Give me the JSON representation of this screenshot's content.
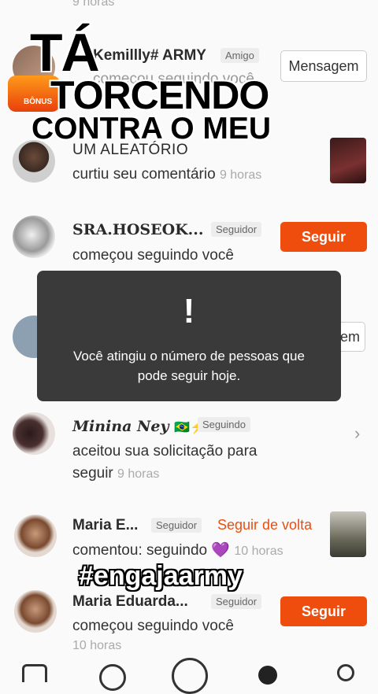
{
  "top_partial_time": "9 horas",
  "overlay": {
    "line1": "TÁ",
    "line2": "TORCENDO",
    "line3": "CONTRA O MEU",
    "hashtag": "#engajaarmy",
    "mini_badge_text": "BÔNUS"
  },
  "notifications": [
    {
      "name": "Kemillly# ARMY",
      "badge": "Amigo",
      "message": "começou seguindo você",
      "action": "Mensagem"
    },
    {
      "name": "UM ALEATÓRIO",
      "message": "curtiu seu comentário",
      "time": "9 horas"
    },
    {
      "name": "SRA.HOSEOK...",
      "badge": "Seguidor",
      "message": "começou seguindo você",
      "action": "Seguir"
    },
    {
      "action_partial": "em"
    },
    {
      "name": "Minina Ney",
      "emoji": "🇧🇷⚡",
      "badge": "Seguindo",
      "message": "aceitou sua solicitação para",
      "message2": "seguir",
      "time": "9 horas"
    },
    {
      "name": "Maria E...",
      "badge": "Seguidor",
      "action": "Seguir de volta",
      "message": "comentou: seguindo",
      "emoji": "💜",
      "time": "10 horas"
    },
    {
      "name": "Maria Eduarda...",
      "badge": "Seguidor",
      "message": "começou seguindo você",
      "time": "10 horas",
      "action": "Seguir"
    }
  ],
  "toast": {
    "icon": "!",
    "line1": "Você atingiu o número de pessoas que",
    "line2": "pode seguir hoje."
  },
  "colors": {
    "accent": "#ee4d0e",
    "toast_bg": "#3a3a3a"
  }
}
